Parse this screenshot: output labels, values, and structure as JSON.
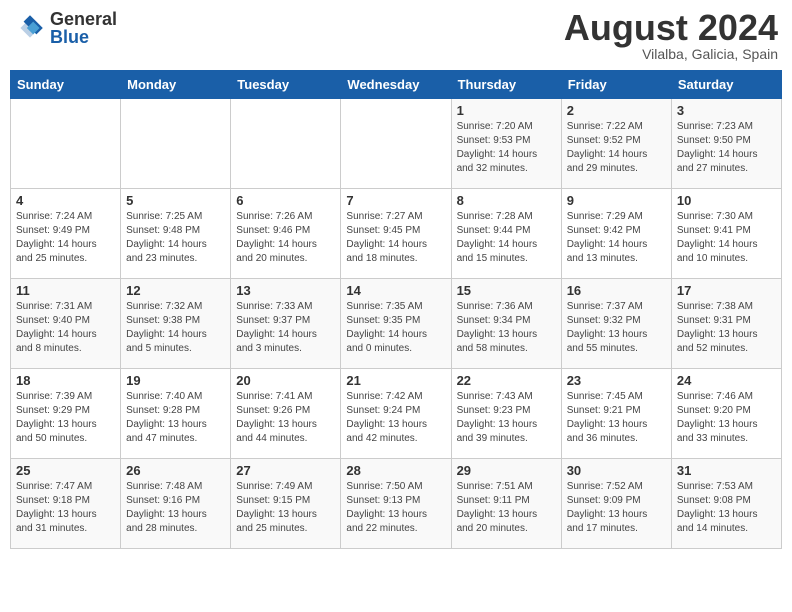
{
  "header": {
    "logo_general": "General",
    "logo_blue": "Blue",
    "month_year": "August 2024",
    "location": "Vilalba, Galicia, Spain"
  },
  "days_of_week": [
    "Sunday",
    "Monday",
    "Tuesday",
    "Wednesday",
    "Thursday",
    "Friday",
    "Saturday"
  ],
  "weeks": [
    [
      {
        "day": "",
        "info": ""
      },
      {
        "day": "",
        "info": ""
      },
      {
        "day": "",
        "info": ""
      },
      {
        "day": "",
        "info": ""
      },
      {
        "day": "1",
        "info": "Sunrise: 7:20 AM\nSunset: 9:53 PM\nDaylight: 14 hours\nand 32 minutes."
      },
      {
        "day": "2",
        "info": "Sunrise: 7:22 AM\nSunset: 9:52 PM\nDaylight: 14 hours\nand 29 minutes."
      },
      {
        "day": "3",
        "info": "Sunrise: 7:23 AM\nSunset: 9:50 PM\nDaylight: 14 hours\nand 27 minutes."
      }
    ],
    [
      {
        "day": "4",
        "info": "Sunrise: 7:24 AM\nSunset: 9:49 PM\nDaylight: 14 hours\nand 25 minutes."
      },
      {
        "day": "5",
        "info": "Sunrise: 7:25 AM\nSunset: 9:48 PM\nDaylight: 14 hours\nand 23 minutes."
      },
      {
        "day": "6",
        "info": "Sunrise: 7:26 AM\nSunset: 9:46 PM\nDaylight: 14 hours\nand 20 minutes."
      },
      {
        "day": "7",
        "info": "Sunrise: 7:27 AM\nSunset: 9:45 PM\nDaylight: 14 hours\nand 18 minutes."
      },
      {
        "day": "8",
        "info": "Sunrise: 7:28 AM\nSunset: 9:44 PM\nDaylight: 14 hours\nand 15 minutes."
      },
      {
        "day": "9",
        "info": "Sunrise: 7:29 AM\nSunset: 9:42 PM\nDaylight: 14 hours\nand 13 minutes."
      },
      {
        "day": "10",
        "info": "Sunrise: 7:30 AM\nSunset: 9:41 PM\nDaylight: 14 hours\nand 10 minutes."
      }
    ],
    [
      {
        "day": "11",
        "info": "Sunrise: 7:31 AM\nSunset: 9:40 PM\nDaylight: 14 hours\nand 8 minutes."
      },
      {
        "day": "12",
        "info": "Sunrise: 7:32 AM\nSunset: 9:38 PM\nDaylight: 14 hours\nand 5 minutes."
      },
      {
        "day": "13",
        "info": "Sunrise: 7:33 AM\nSunset: 9:37 PM\nDaylight: 14 hours\nand 3 minutes."
      },
      {
        "day": "14",
        "info": "Sunrise: 7:35 AM\nSunset: 9:35 PM\nDaylight: 14 hours\nand 0 minutes."
      },
      {
        "day": "15",
        "info": "Sunrise: 7:36 AM\nSunset: 9:34 PM\nDaylight: 13 hours\nand 58 minutes."
      },
      {
        "day": "16",
        "info": "Sunrise: 7:37 AM\nSunset: 9:32 PM\nDaylight: 13 hours\nand 55 minutes."
      },
      {
        "day": "17",
        "info": "Sunrise: 7:38 AM\nSunset: 9:31 PM\nDaylight: 13 hours\nand 52 minutes."
      }
    ],
    [
      {
        "day": "18",
        "info": "Sunrise: 7:39 AM\nSunset: 9:29 PM\nDaylight: 13 hours\nand 50 minutes."
      },
      {
        "day": "19",
        "info": "Sunrise: 7:40 AM\nSunset: 9:28 PM\nDaylight: 13 hours\nand 47 minutes."
      },
      {
        "day": "20",
        "info": "Sunrise: 7:41 AM\nSunset: 9:26 PM\nDaylight: 13 hours\nand 44 minutes."
      },
      {
        "day": "21",
        "info": "Sunrise: 7:42 AM\nSunset: 9:24 PM\nDaylight: 13 hours\nand 42 minutes."
      },
      {
        "day": "22",
        "info": "Sunrise: 7:43 AM\nSunset: 9:23 PM\nDaylight: 13 hours\nand 39 minutes."
      },
      {
        "day": "23",
        "info": "Sunrise: 7:45 AM\nSunset: 9:21 PM\nDaylight: 13 hours\nand 36 minutes."
      },
      {
        "day": "24",
        "info": "Sunrise: 7:46 AM\nSunset: 9:20 PM\nDaylight: 13 hours\nand 33 minutes."
      }
    ],
    [
      {
        "day": "25",
        "info": "Sunrise: 7:47 AM\nSunset: 9:18 PM\nDaylight: 13 hours\nand 31 minutes."
      },
      {
        "day": "26",
        "info": "Sunrise: 7:48 AM\nSunset: 9:16 PM\nDaylight: 13 hours\nand 28 minutes."
      },
      {
        "day": "27",
        "info": "Sunrise: 7:49 AM\nSunset: 9:15 PM\nDaylight: 13 hours\nand 25 minutes."
      },
      {
        "day": "28",
        "info": "Sunrise: 7:50 AM\nSunset: 9:13 PM\nDaylight: 13 hours\nand 22 minutes."
      },
      {
        "day": "29",
        "info": "Sunrise: 7:51 AM\nSunset: 9:11 PM\nDaylight: 13 hours\nand 20 minutes."
      },
      {
        "day": "30",
        "info": "Sunrise: 7:52 AM\nSunset: 9:09 PM\nDaylight: 13 hours\nand 17 minutes."
      },
      {
        "day": "31",
        "info": "Sunrise: 7:53 AM\nSunset: 9:08 PM\nDaylight: 13 hours\nand 14 minutes."
      }
    ]
  ]
}
